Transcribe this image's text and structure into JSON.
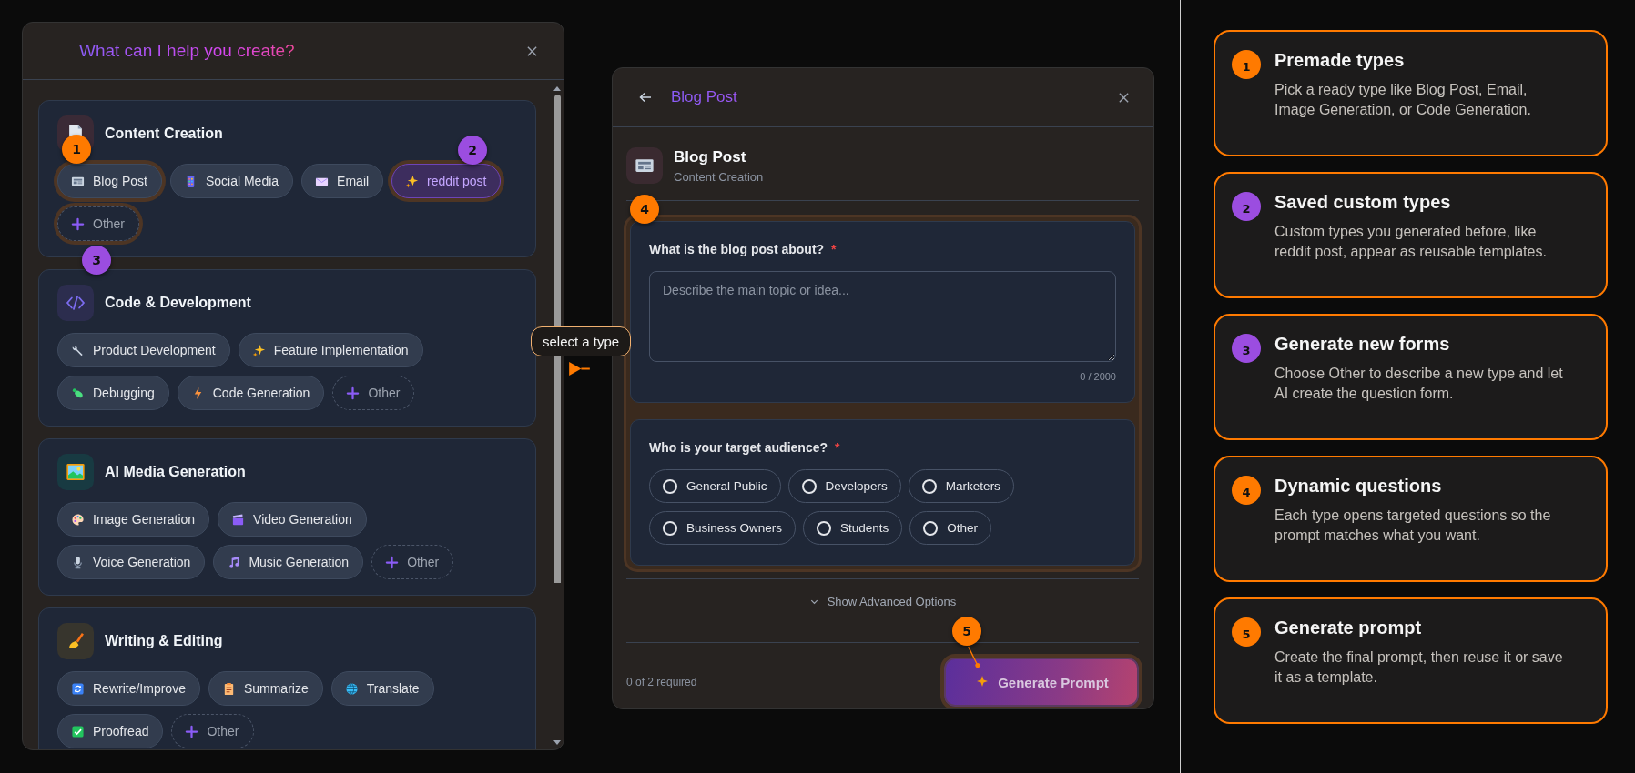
{
  "type_picker": {
    "title": "What can I help you create?",
    "categories": [
      {
        "title": "Content Creation",
        "chips": [
          {
            "label": "Blog Post",
            "kind": "premade",
            "highlighted": true
          },
          {
            "label": "Social Media",
            "kind": "premade",
            "highlighted": false
          },
          {
            "label": "Email",
            "kind": "premade",
            "highlighted": false
          },
          {
            "label": "reddit post",
            "kind": "custom",
            "highlighted": true
          },
          {
            "label": "Other",
            "kind": "other",
            "highlighted": true
          }
        ]
      },
      {
        "title": "Code & Development",
        "chips": [
          {
            "label": "Product Development",
            "kind": "premade",
            "highlighted": false
          },
          {
            "label": "Feature Implementation",
            "kind": "premade",
            "highlighted": false
          },
          {
            "label": "Debugging",
            "kind": "premade",
            "highlighted": false
          },
          {
            "label": "Code Generation",
            "kind": "premade",
            "highlighted": false
          },
          {
            "label": "Other",
            "kind": "other",
            "highlighted": false
          }
        ]
      },
      {
        "title": "AI Media Generation",
        "chips": [
          {
            "label": "Image Generation",
            "kind": "premade",
            "highlighted": false
          },
          {
            "label": "Video Generation",
            "kind": "premade",
            "highlighted": false
          },
          {
            "label": "Voice Generation",
            "kind": "premade",
            "highlighted": false
          },
          {
            "label": "Music Generation",
            "kind": "premade",
            "highlighted": false
          },
          {
            "label": "Other",
            "kind": "other",
            "highlighted": false
          }
        ]
      },
      {
        "title": "Writing & Editing",
        "chips": [
          {
            "label": "Rewrite/Improve",
            "kind": "premade",
            "highlighted": false
          },
          {
            "label": "Summarize",
            "kind": "premade",
            "highlighted": false
          },
          {
            "label": "Translate",
            "kind": "premade",
            "highlighted": false
          },
          {
            "label": "Proofread",
            "kind": "premade",
            "highlighted": false
          },
          {
            "label": "Other",
            "kind": "other",
            "highlighted": false
          }
        ]
      }
    ]
  },
  "tooltip": {
    "text": "select a type"
  },
  "form": {
    "title": "Blog Post",
    "type_name": "Blog Post",
    "type_category": "Content Creation",
    "questions_highlighted": true,
    "questions": [
      {
        "kind": "text",
        "label": "What is the blog post about?",
        "required_mark": "*",
        "placeholder": "Describe the main topic or idea...",
        "counter": "0 / 2000"
      },
      {
        "kind": "choice",
        "label": "Who is your target audience?",
        "required_mark": "*",
        "options": [
          {
            "label": "General Public",
            "selected": false
          },
          {
            "label": "Developers",
            "selected": false
          },
          {
            "label": "Marketers",
            "selected": false
          },
          {
            "label": "Business Owners",
            "selected": false
          },
          {
            "label": "Students",
            "selected": false
          },
          {
            "label": "Other",
            "selected": false
          }
        ]
      }
    ],
    "advanced_toggle": "Show Advanced Options",
    "progress": "0 of 2 required",
    "submit": {
      "label": "Generate Prompt",
      "highlighted": true
    }
  },
  "callouts": [
    {
      "number": "1",
      "color": "#ff7a00"
    },
    {
      "number": "2",
      "color": "#9b4de0"
    },
    {
      "number": "3",
      "color": "#9b4de0"
    },
    {
      "number": "4",
      "color": "#ff7a00"
    },
    {
      "number": "5",
      "color": "#ff7a00"
    }
  ],
  "steps": [
    {
      "number": "1",
      "color": "#ff7a00",
      "title": "Premade types",
      "text": "Pick a ready type like Blog Post, Email, Image Generation, or Code Generation."
    },
    {
      "number": "2",
      "color": "#9b4de0",
      "title": "Saved custom types",
      "text": "Custom types you generated before, like reddit post, appear as reusable templates."
    },
    {
      "number": "3",
      "color": "#9b4de0",
      "title": "Generate new forms",
      "text": "Choose Other to describe a new type and let AI create the question form."
    },
    {
      "number": "4",
      "color": "#ff7a00",
      "title": "Dynamic questions",
      "text": "Each type opens targeted questions so the prompt matches what you want."
    },
    {
      "number": "5",
      "color": "#ff7a00",
      "title": "Generate prompt",
      "text": "Create the final prompt, then reuse it or save it as a template."
    }
  ]
}
